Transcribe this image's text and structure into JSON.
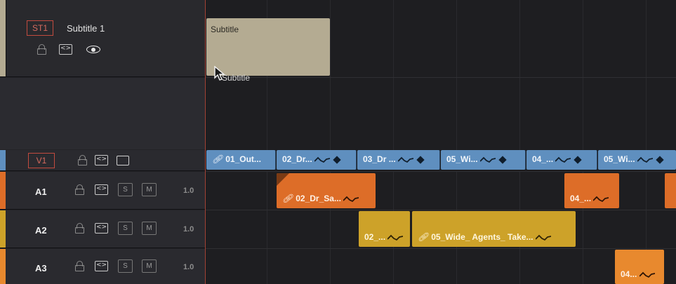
{
  "tracks": {
    "st1": {
      "code": "ST1",
      "name": "Subtitle 1"
    },
    "v1": {
      "code": "V1"
    },
    "a1": {
      "id": "A1",
      "solo": "S",
      "mute": "M",
      "volume": "1.0"
    },
    "a2": {
      "id": "A2",
      "solo": "S",
      "mute": "M",
      "volume": "1.0"
    },
    "a3": {
      "id": "A3",
      "solo": "S",
      "mute": "M",
      "volume": "1.0"
    }
  },
  "subtitle_clip": {
    "label": "Subtitle"
  },
  "drag_ghost": {
    "label": "Subtitle"
  },
  "video_clips": [
    {
      "label": "01_Out..."
    },
    {
      "label": "02_Dr..."
    },
    {
      "label": "03_Dr ..."
    },
    {
      "label": "05_Wi..."
    },
    {
      "label": "04_..."
    },
    {
      "label": "05_Wi..."
    }
  ],
  "a1_clips": [
    {
      "label": "02_Dr_Sa..."
    },
    {
      "label": "04_..."
    }
  ],
  "a2_clips": [
    {
      "label": "02_..."
    },
    {
      "label": "05_Wide_ Agents_ Take..."
    }
  ],
  "a3_clips": [
    {
      "label": "04..."
    }
  ],
  "colors": {
    "subtitle_track": "#b4ab92",
    "video_track": "#5f8fbf",
    "audio_a1": "#dd6d28",
    "audio_a2": "#cda229",
    "audio_a3": "#e8892e",
    "playhead": "#a14134"
  },
  "icons": {
    "lock": "lock-icon",
    "auto_select": "auto-select-icon",
    "visibility": "eye-icon",
    "monitor": "monitor-icon",
    "link": "link-icon",
    "waveform": "waveform-icon",
    "keyframe": "keyframe-diamond-icon",
    "cursor": "pointer-cursor-icon"
  }
}
